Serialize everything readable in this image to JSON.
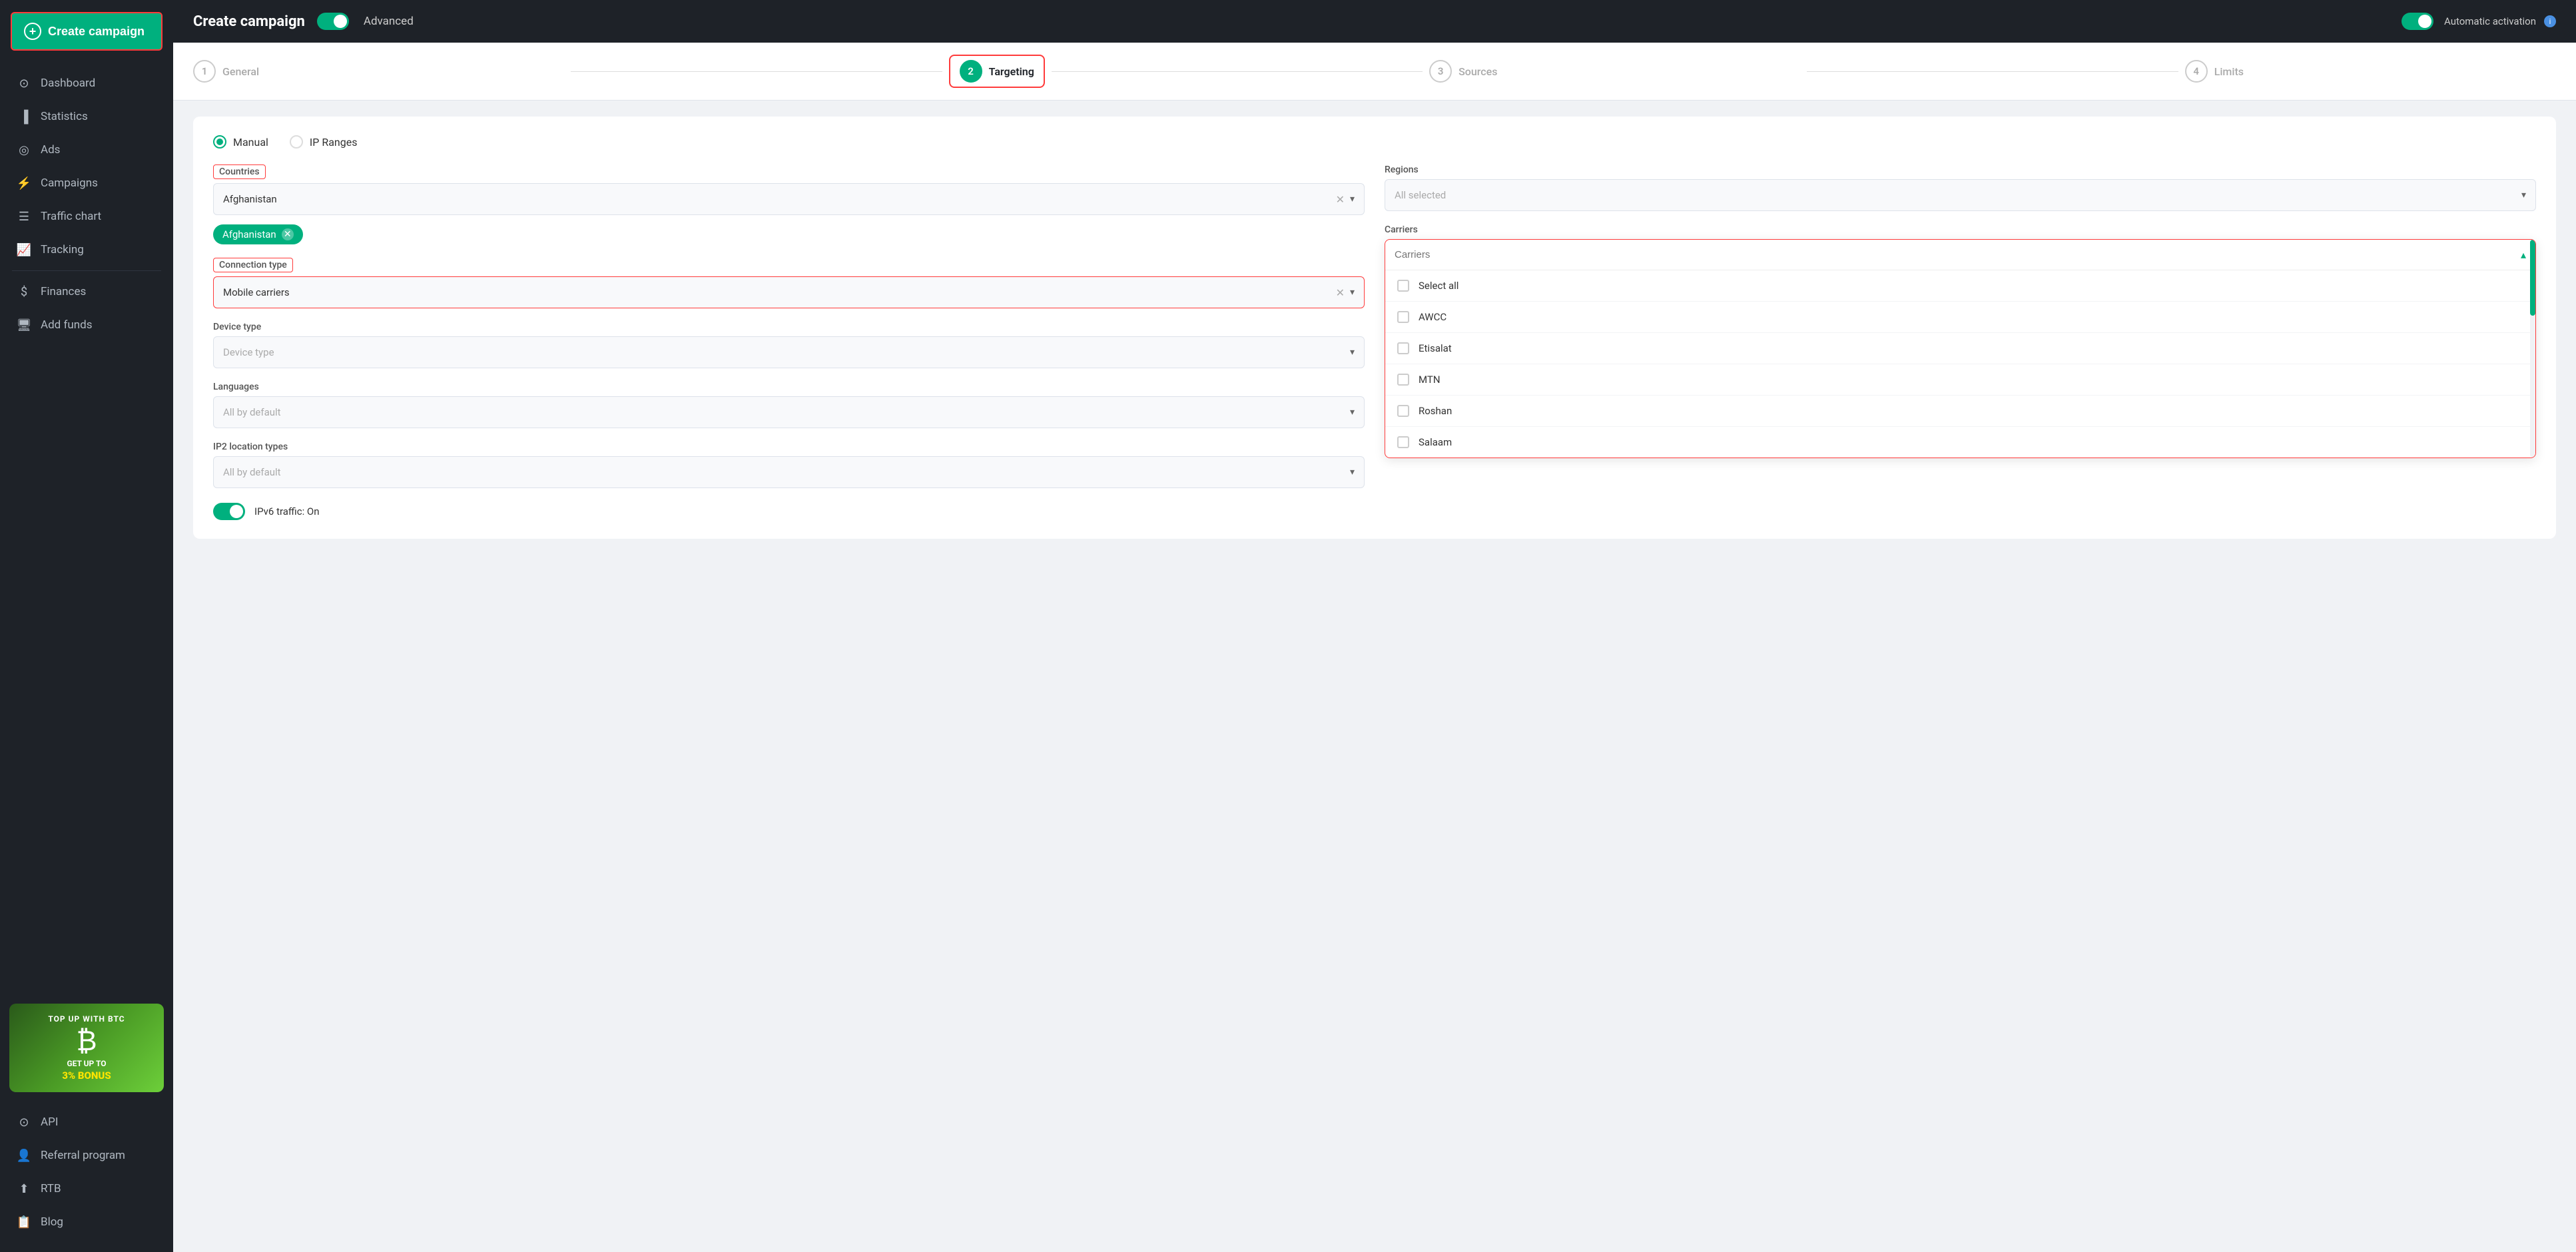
{
  "sidebar": {
    "create_btn": "Create campaign",
    "nav_items": [
      {
        "id": "dashboard",
        "label": "Dashboard",
        "icon": "⊙"
      },
      {
        "id": "statistics",
        "label": "Statistics",
        "icon": "▐"
      },
      {
        "id": "ads",
        "label": "Ads",
        "icon": "🔊"
      },
      {
        "id": "campaigns",
        "label": "Campaigns",
        "icon": "⚡"
      },
      {
        "id": "traffic-chart",
        "label": "Traffic chart",
        "icon": "☰"
      },
      {
        "id": "tracking",
        "label": "Tracking",
        "icon": "📈"
      },
      {
        "id": "finances",
        "label": "Finances",
        "icon": "$"
      },
      {
        "id": "add-funds",
        "label": "Add funds",
        "icon": "🖥"
      }
    ],
    "bottom_items": [
      {
        "id": "api",
        "label": "API",
        "icon": "⊙"
      },
      {
        "id": "referral",
        "label": "Referral program",
        "icon": "👤"
      },
      {
        "id": "rtb",
        "label": "RTB",
        "icon": "⬆"
      },
      {
        "id": "blog",
        "label": "Blog",
        "icon": "📋"
      }
    ],
    "banner": {
      "line1": "TOP UP WITH BTC",
      "btc_icon": "₿",
      "line2": "GET UP TO",
      "bonus": "3% BONUS"
    }
  },
  "header": {
    "title": "Create campaign",
    "toggle_label": "Advanced",
    "auto_activation": "Automatic activation"
  },
  "steps": [
    {
      "number": "1",
      "label": "General",
      "state": "normal"
    },
    {
      "number": "2",
      "label": "Targeting",
      "state": "active"
    },
    {
      "number": "3",
      "label": "Sources",
      "state": "normal"
    },
    {
      "number": "4",
      "label": "Limits",
      "state": "normal"
    }
  ],
  "targeting": {
    "mode_manual": "Manual",
    "mode_ip_ranges": "IP Ranges",
    "countries_label": "Countries",
    "countries_value": "Afghanistan",
    "countries_tag": "Afghanistan",
    "regions_label": "Regions",
    "regions_placeholder": "All selected",
    "connection_type_label": "Connection type",
    "connection_type_value": "Mobile carriers",
    "device_type_label": "Device type",
    "device_type_placeholder": "Device type",
    "languages_label": "Languages",
    "languages_placeholder": "All by default",
    "ip2_label": "IP2 location types",
    "ip2_placeholder": "All by default",
    "ipv6_label": "IPv6 traffic: On",
    "carriers_label": "Carriers",
    "carriers_search_placeholder": "Carriers",
    "carriers_options": [
      {
        "id": "select-all",
        "label": "Select all",
        "checked": false
      },
      {
        "id": "awcc",
        "label": "AWCC",
        "checked": false
      },
      {
        "id": "etisalat",
        "label": "Etisalat",
        "checked": false
      },
      {
        "id": "mtn",
        "label": "MTN",
        "checked": false
      },
      {
        "id": "roshan",
        "label": "Roshan",
        "checked": false
      },
      {
        "id": "salaam",
        "label": "Salaam",
        "checked": false
      }
    ]
  },
  "colors": {
    "green": "#00b07e",
    "red": "#ff3b3b",
    "dark": "#1e2228"
  }
}
